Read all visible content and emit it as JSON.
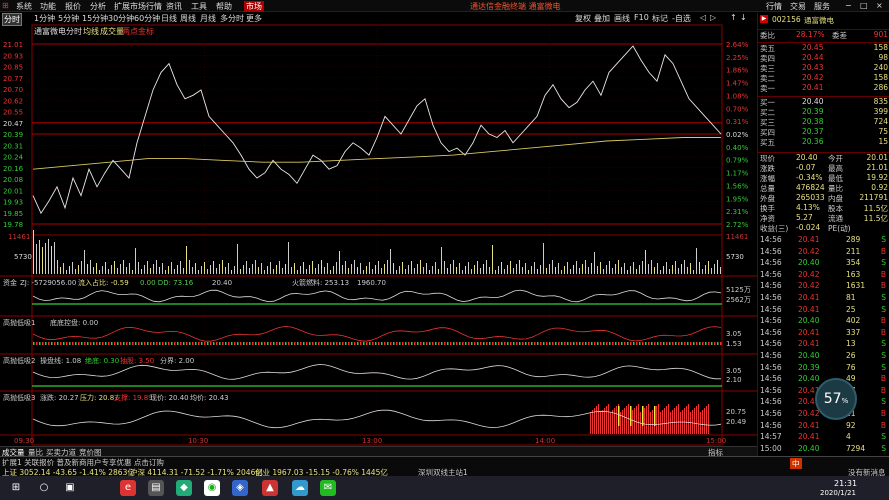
{
  "menubar": {
    "logo": "⊞",
    "items": [
      "系统",
      "功能",
      "报价",
      "分析",
      "扩展市场行情",
      "资讯",
      "工具",
      "帮助"
    ],
    "active_item": "市场",
    "notice": "通达信金融终端  通富微电",
    "right_items": [
      "行情",
      "交易",
      "服务"
    ],
    "window_controls": [
      "−",
      "□",
      "×"
    ]
  },
  "periodbar": {
    "items": [
      "分时",
      "1分钟",
      "5分钟",
      "15分钟",
      "30分钟",
      "60分钟",
      "日线",
      "周线",
      "月线",
      "多分时",
      "更多"
    ],
    "selected": 0,
    "tools": [
      "复权",
      "叠加",
      "画线",
      "F10",
      "标记",
      "-自选",
      "◁",
      "▷",
      "↑",
      "↓"
    ]
  },
  "price_panel": {
    "stock": "通富微电",
    "legend": [
      "分时",
      "均线",
      "成交量",
      "两点金标"
    ],
    "left_prices": [
      "21.01",
      "20.93",
      "20.85",
      "20.77",
      "20.70",
      "20.62",
      "20.55",
      "20.47",
      "20.39",
      "20.31",
      "20.24",
      "20.16",
      "20.08",
      "20.01",
      "19.93",
      "19.85",
      "19.78"
    ],
    "right_pcts": [
      "2.64%",
      "2.25%",
      "1.86%",
      "1.47%",
      "1.08%",
      "0.70%",
      "0.31%",
      "0.02%",
      "0.40%",
      "0.79%",
      "1.17%",
      "1.56%",
      "1.95%",
      "2.31%",
      "2.72%"
    ],
    "vol_left": [
      "11461",
      "5730"
    ],
    "vol_right": [
      "11461",
      "5730"
    ]
  },
  "chart_data": {
    "type": "line",
    "x": [
      "09:30",
      "10:30",
      "13:00",
      "14:00",
      "15:00"
    ],
    "series": [
      {
        "values": [
          20.15,
          20.41,
          20.86,
          20.45,
          20.4
        ]
      },
      {
        "values": [
          20.2,
          20.3,
          20.28,
          20.33,
          20.38
        ]
      }
    ],
    "ylim": [
      19.78,
      21.01
    ]
  },
  "ind1": {
    "label": "资金",
    "value": "ZJ: -5729056.00",
    "inflow_label": "流入占比: -0.59",
    "dd": "0.00 DD: 73.16",
    "v": "20.40",
    "sh": "火箭燃料: 253.13",
    "val2": "1960.70",
    "right1": "5125万",
    "right2": "2562万"
  },
  "ind2": {
    "label": "高抛低吸1",
    "name": "底底控盘: 0.00",
    "right1": "3.05",
    "right2": "1.53"
  },
  "ind3": {
    "label": "高抛低吸2",
    "a": "操盘线: 1.08",
    "b": "绝底: 0.30",
    "c": "抽股: 3.50",
    "d": "分界: 2.00",
    "right1": "3.05",
    "right2": "2.10"
  },
  "ind4": {
    "label": "高抛低吸3",
    "a": "涨跌: 20.27",
    "b": "压力: 20.87",
    "c": "支撑: 19.89",
    "d": "现价: 20.40",
    "e": "均价: 20.43",
    "right1": "20.75",
    "right2": "20.49"
  },
  "x_labels": [
    "09:30",
    "10:30",
    "13:00",
    "14:00",
    "15:00"
  ],
  "bottom_tabs": [
    "成交量",
    "量比",
    "买卖力道",
    "竞价图"
  ],
  "bottom_right": "指标",
  "quote": {
    "code": "002156",
    "name": "通富微电",
    "ratio_label": "委比",
    "ratio": "28.17%",
    "diff_label": "委差",
    "diff": "901",
    "asks": [
      {
        "label": "卖五",
        "price": "20.45",
        "vol": "158"
      },
      {
        "label": "卖四",
        "price": "20.44",
        "vol": "98"
      },
      {
        "label": "卖三",
        "price": "20.43",
        "vol": "240"
      },
      {
        "label": "卖二",
        "price": "20.42",
        "vol": "158"
      },
      {
        "label": "卖一",
        "price": "20.41",
        "vol": "286"
      }
    ],
    "bids": [
      {
        "label": "买一",
        "price": "20.40",
        "vol": "835"
      },
      {
        "label": "买二",
        "price": "20.39",
        "vol": "399"
      },
      {
        "label": "买三",
        "price": "20.38",
        "vol": "724"
      },
      {
        "label": "买四",
        "price": "20.37",
        "vol": "75"
      },
      {
        "label": "买五",
        "price": "20.36",
        "vol": "15"
      }
    ],
    "stats": [
      [
        "现价",
        "20.40",
        "今开",
        "20.01"
      ],
      [
        "涨跌",
        "-0.07",
        "最高",
        "21.01"
      ],
      [
        "涨幅",
        "-0.34%",
        "最低",
        "19.92"
      ],
      [
        "总量",
        "476824",
        "量比",
        "0.92"
      ],
      [
        "外盘",
        "265033",
        "内盘",
        "211791"
      ],
      [
        "换手",
        "4.13%",
        "股本",
        "11.5亿"
      ],
      [
        "净资",
        "5.27",
        "流通",
        "11.5亿"
      ],
      [
        "收益(三)",
        "-0.024",
        "PE(动)",
        ""
      ]
    ],
    "ticks": [
      [
        "14:56",
        "20.41",
        "289",
        "S"
      ],
      [
        "14:56",
        "20.42",
        "211",
        "B"
      ],
      [
        "14:56",
        "20.40",
        "354",
        "S"
      ],
      [
        "14:56",
        "20.42",
        "163",
        "B"
      ],
      [
        "14:56",
        "20.42",
        "1631",
        "B"
      ],
      [
        "14:56",
        "20.41",
        "81",
        "S"
      ],
      [
        "14:56",
        "20.41",
        "25",
        "S"
      ],
      [
        "14:56",
        "20.40",
        "402",
        "B"
      ],
      [
        "14:56",
        "20.41",
        "337",
        "B"
      ],
      [
        "14:56",
        "20.41",
        "13",
        "S"
      ],
      [
        "14:56",
        "20.40",
        "26",
        "S"
      ],
      [
        "14:56",
        "20.39",
        "76",
        "S"
      ],
      [
        "14:56",
        "20.40",
        "49",
        "B"
      ],
      [
        "14:56",
        "20.41",
        "37",
        "B"
      ],
      [
        "14:56",
        "20.41",
        "13",
        "S"
      ],
      [
        "14:56",
        "20.42",
        "21",
        "B"
      ],
      [
        "14:56",
        "20.41",
        "92",
        "B"
      ],
      [
        "14:57",
        "20.41",
        "4",
        "S"
      ],
      [
        "15:00",
        "20.40",
        "7294",
        "S"
      ]
    ]
  },
  "status": {
    "left": "扩展1 关联报价 普及新商用户专享优惠 点击订购",
    "sh": "上证 3052.14 -43.65 -1.41% 2863亿",
    "sz": "沪深 4114.31 -71.52 -1.71% 2046亿",
    "cy": "创业 1967.03 -15.15 -0.76% 1445亿",
    "site": "深圳双线主站1",
    "ime": "中",
    "news": "没有新消息"
  },
  "clock_bubble": "57",
  "clock_bubble_sub": "%",
  "taskbar": {
    "time": "21:31",
    "date": "2020/1/21"
  }
}
